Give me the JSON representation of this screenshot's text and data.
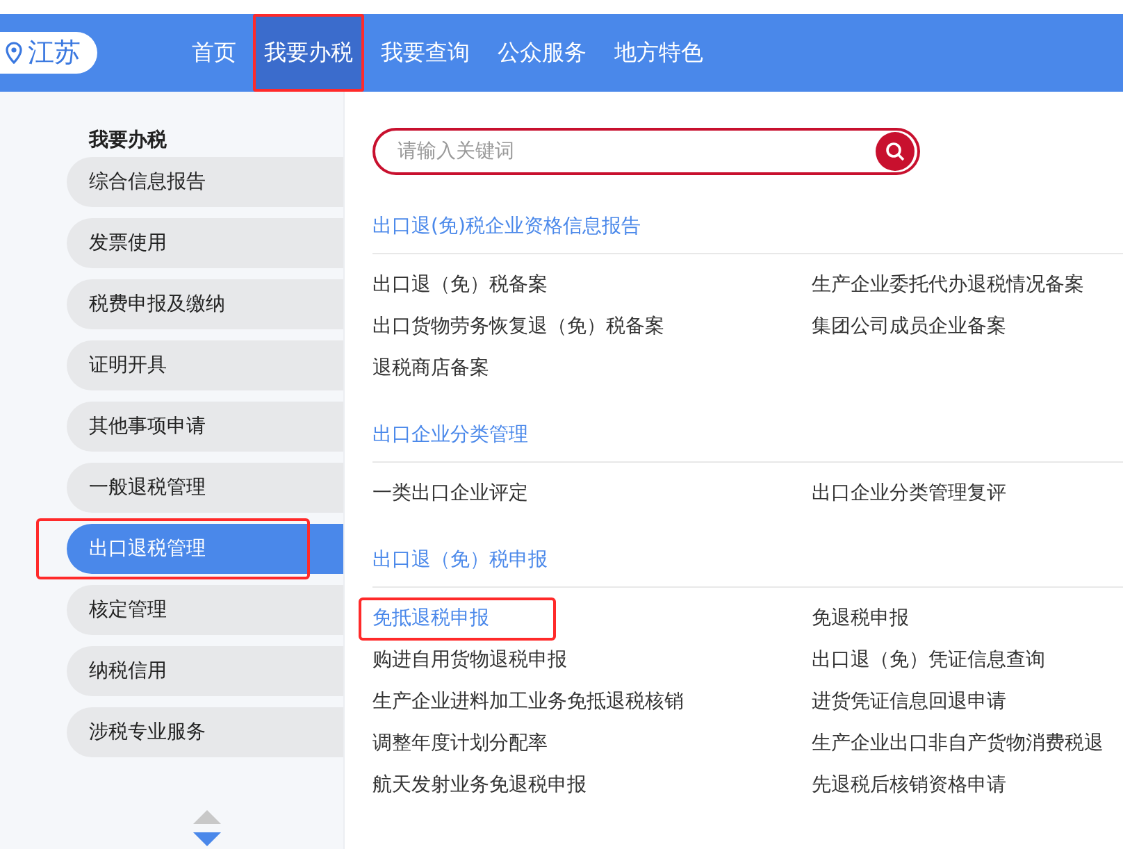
{
  "header": {
    "region": "江苏",
    "nav": [
      {
        "label": "首页",
        "selected": false,
        "highlighted": false
      },
      {
        "label": "我要办税",
        "selected": true,
        "highlighted": true
      },
      {
        "label": "我要查询",
        "selected": false,
        "highlighted": false
      },
      {
        "label": "公众服务",
        "selected": false,
        "highlighted": false
      },
      {
        "label": "地方特色",
        "selected": false,
        "highlighted": false
      }
    ]
  },
  "sidebar": {
    "title": "我要办税",
    "items": [
      {
        "label": "综合信息报告",
        "selected": false,
        "highlighted": false
      },
      {
        "label": "发票使用",
        "selected": false,
        "highlighted": false
      },
      {
        "label": "税费申报及缴纳",
        "selected": false,
        "highlighted": false
      },
      {
        "label": "证明开具",
        "selected": false,
        "highlighted": false
      },
      {
        "label": "其他事项申请",
        "selected": false,
        "highlighted": false
      },
      {
        "label": "一般退税管理",
        "selected": false,
        "highlighted": false
      },
      {
        "label": "出口退税管理",
        "selected": true,
        "highlighted": true
      },
      {
        "label": "核定管理",
        "selected": false,
        "highlighted": false
      },
      {
        "label": "纳税信用",
        "selected": false,
        "highlighted": false
      },
      {
        "label": "涉税专业服务",
        "selected": false,
        "highlighted": false
      }
    ]
  },
  "search": {
    "placeholder": "请输入关键词"
  },
  "sections": [
    {
      "title": "出口退(免)税企业资格信息报告",
      "links": [
        {
          "label": "出口退（免）税备案",
          "highlighted": false
        },
        {
          "label": "生产企业委托代办退税情况备案",
          "highlighted": false
        },
        {
          "label": "出口货物劳务恢复退（免）税备案",
          "highlighted": false
        },
        {
          "label": "集团公司成员企业备案",
          "highlighted": false
        },
        {
          "label": "退税商店备案",
          "highlighted": false
        }
      ]
    },
    {
      "title": "出口企业分类管理",
      "links": [
        {
          "label": "一类出口企业评定",
          "highlighted": false
        },
        {
          "label": "出口企业分类管理复评",
          "highlighted": false
        }
      ]
    },
    {
      "title": "出口退（免）税申报",
      "links": [
        {
          "label": "免抵退税申报",
          "highlighted": true
        },
        {
          "label": "免退税申报",
          "highlighted": false
        },
        {
          "label": "购进自用货物退税申报",
          "highlighted": false
        },
        {
          "label": "出口退（免）凭证信息查询",
          "highlighted": false
        },
        {
          "label": "生产企业进料加工业务免抵退税核销",
          "highlighted": false
        },
        {
          "label": "进货凭证信息回退申请",
          "highlighted": false
        },
        {
          "label": "调整年度计划分配率",
          "highlighted": false
        },
        {
          "label": "生产企业出口非自产货物消费税退",
          "highlighted": false
        },
        {
          "label": "航天发射业务免退税申报",
          "highlighted": false
        },
        {
          "label": "先退税后核销资格申请",
          "highlighted": false
        }
      ]
    }
  ]
}
